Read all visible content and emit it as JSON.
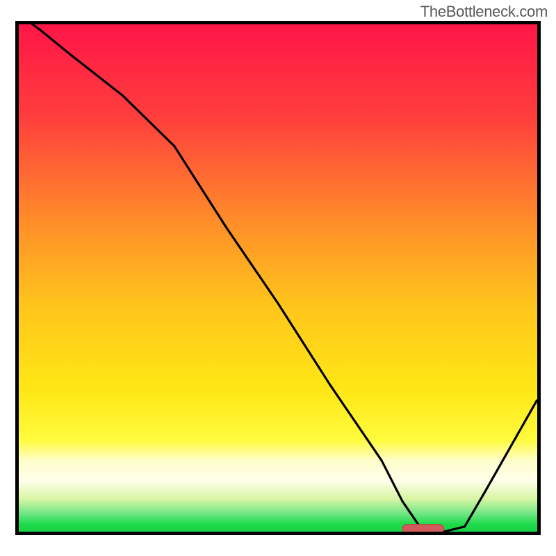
{
  "watermark": "TheBottleneck.com",
  "colors": {
    "frame": "#000000",
    "band_pale": "#fffde6",
    "green_bright": "#1edb4a",
    "curve": "#000000",
    "marker_fill": "#d25a5a",
    "marker_edge": "#b64646"
  },
  "chart_data": {
    "type": "line",
    "title": "",
    "xlabel": "",
    "ylabel": "",
    "xlim": [
      0,
      100
    ],
    "ylim": [
      0,
      100
    ],
    "series": [
      {
        "name": "bottleneck-curve",
        "x": [
          0,
          4,
          10,
          20,
          28,
          30,
          40,
          50,
          60,
          70,
          74,
          78,
          82,
          86,
          90,
          95,
          100
        ],
        "y": [
          102,
          99,
          94,
          86,
          78,
          76,
          60,
          45,
          29,
          14,
          6,
          0,
          0,
          1,
          8,
          17,
          26
        ]
      }
    ],
    "marker": {
      "x_start": 74,
      "x_end": 82,
      "y": 0.6,
      "label": ""
    },
    "background_gradient": {
      "stops": [
        {
          "pos": 0.0,
          "color": "#ff1648"
        },
        {
          "pos": 0.18,
          "color": "#ff3d3d"
        },
        {
          "pos": 0.38,
          "color": "#ff8a2a"
        },
        {
          "pos": 0.55,
          "color": "#ffc41c"
        },
        {
          "pos": 0.72,
          "color": "#ffe715"
        },
        {
          "pos": 0.82,
          "color": "#fffb3e"
        },
        {
          "pos": 0.86,
          "color": "#fffecb"
        },
        {
          "pos": 0.9,
          "color": "#fffeea"
        },
        {
          "pos": 0.935,
          "color": "#d9f5a4"
        },
        {
          "pos": 0.965,
          "color": "#6fe684"
        },
        {
          "pos": 0.985,
          "color": "#1edb4a"
        },
        {
          "pos": 1.0,
          "color": "#18d244"
        }
      ]
    }
  }
}
